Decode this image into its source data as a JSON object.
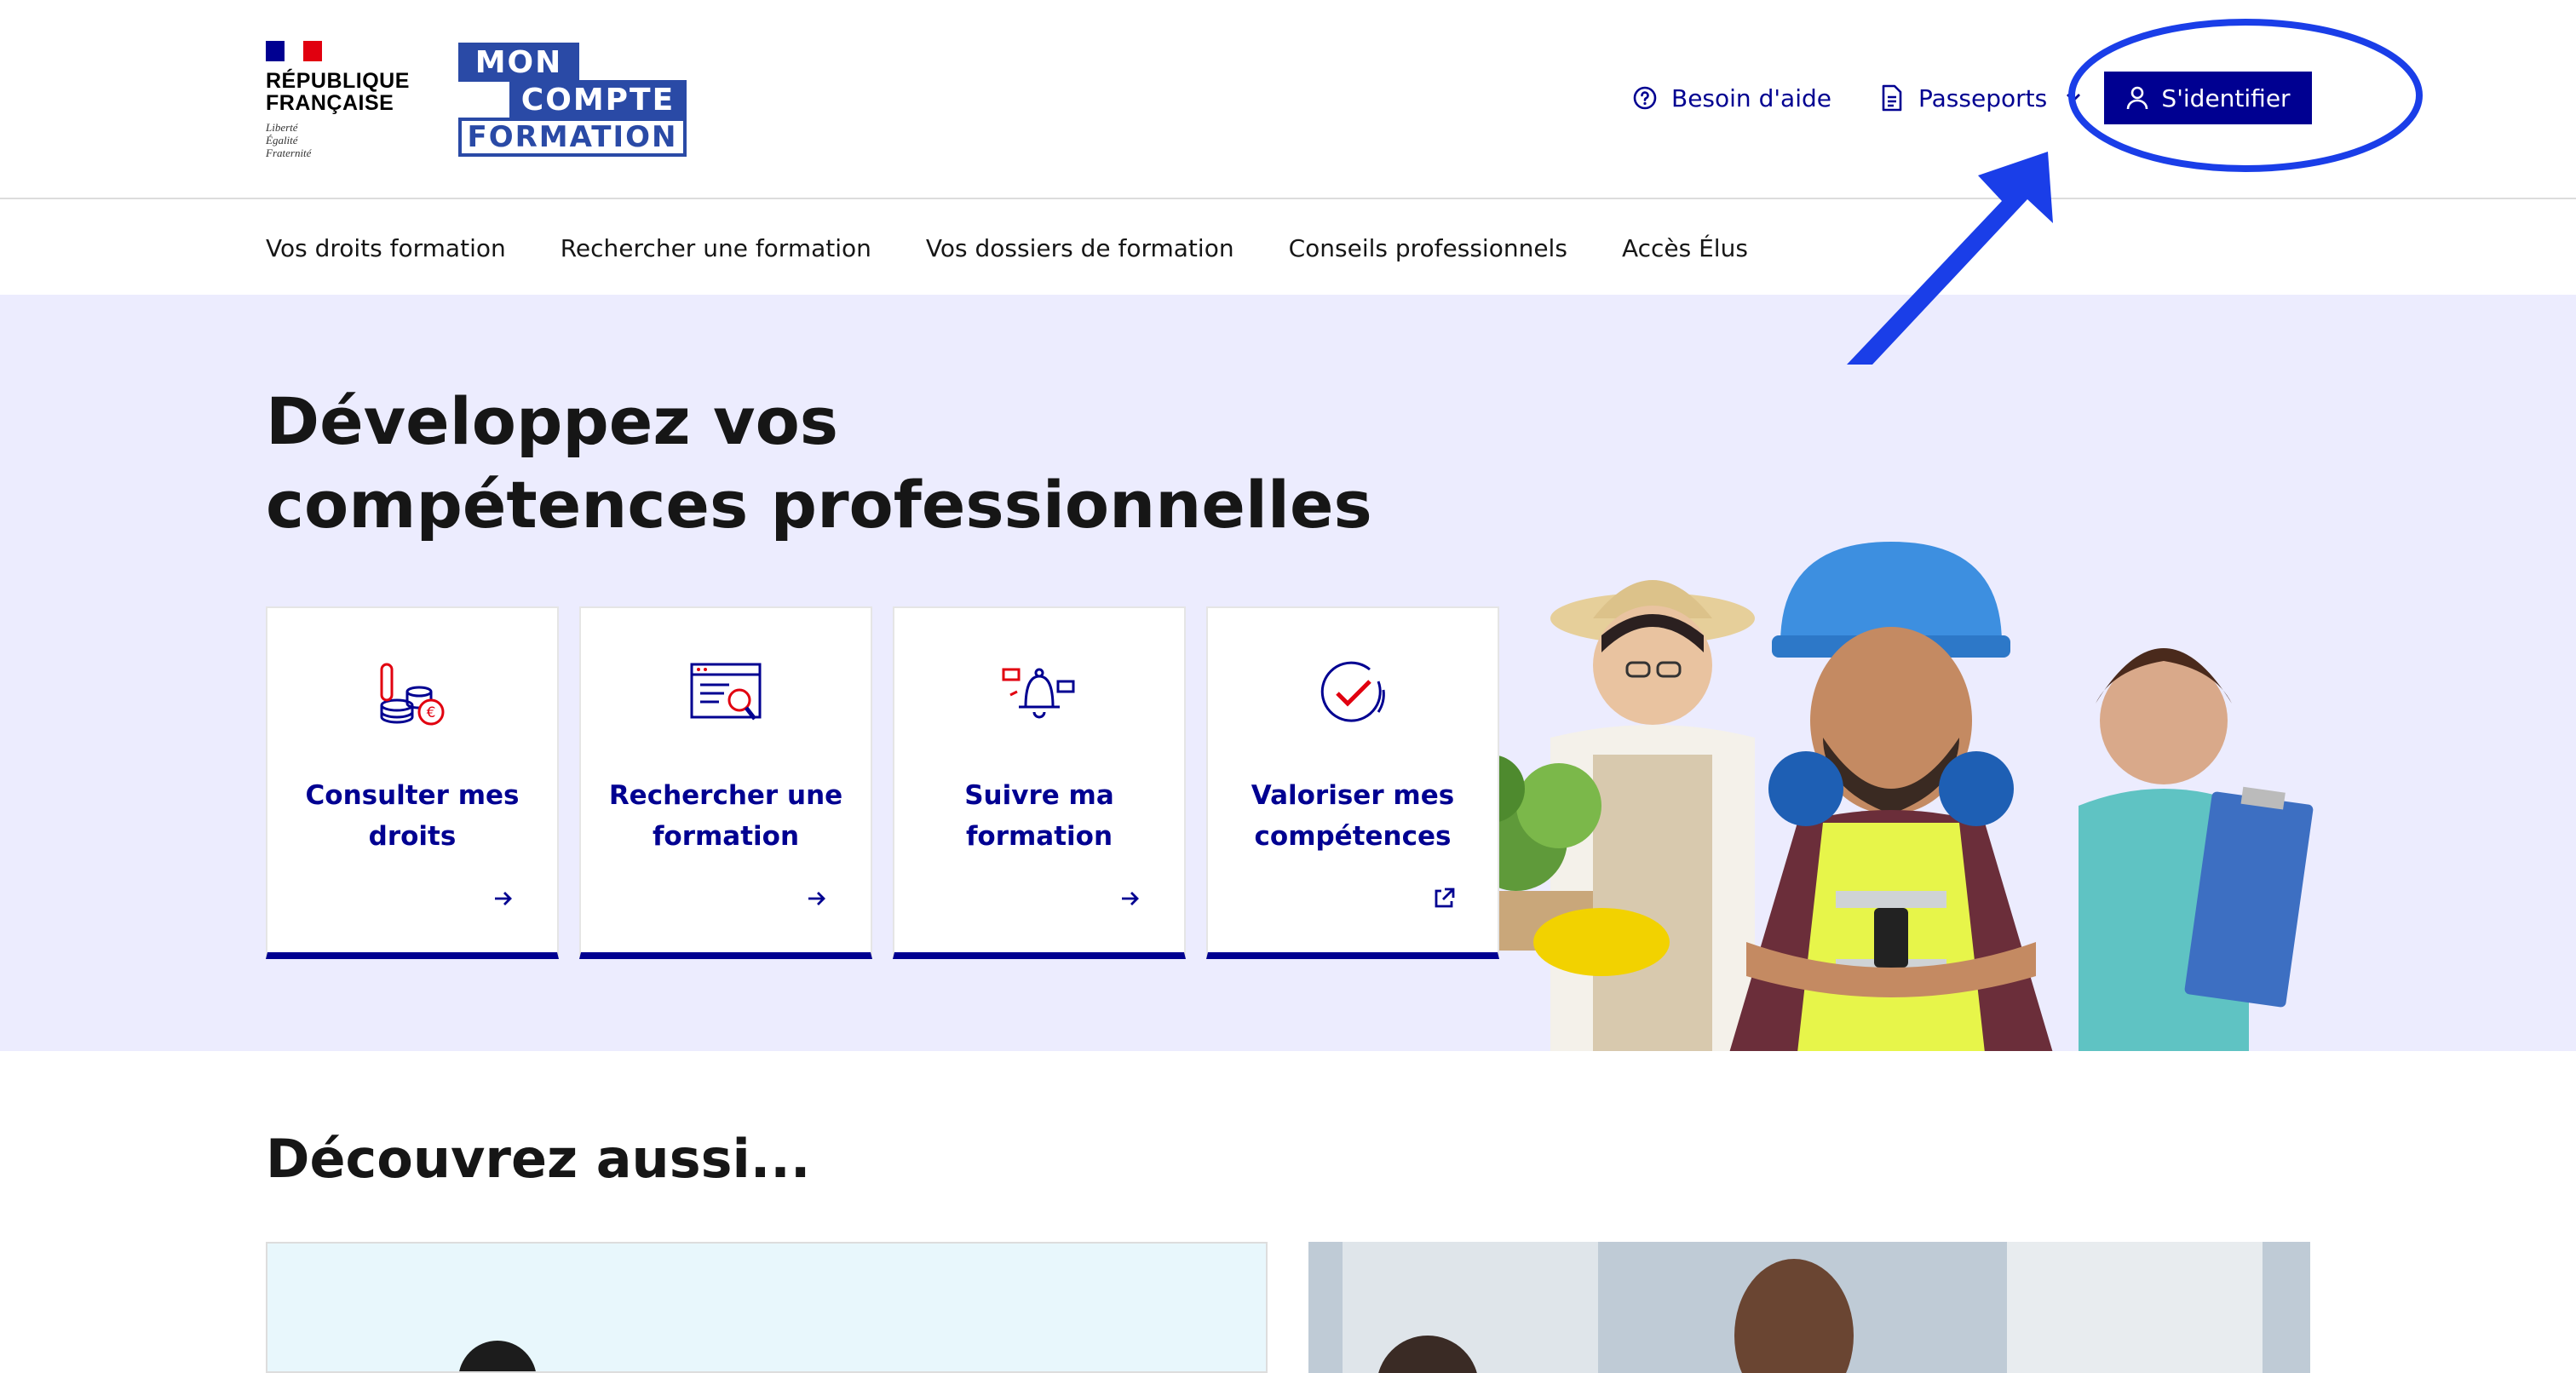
{
  "header": {
    "republic": {
      "name_line1": "RÉPUBLIQUE",
      "name_line2": "FRANÇAISE",
      "motto_line1": "Liberté",
      "motto_line2": "Égalité",
      "motto_line3": "Fraternité"
    },
    "logo": {
      "line1": "MON",
      "line2": "COMPTE",
      "line3": "FORMATION"
    },
    "help_label": "Besoin d'aide",
    "passports_label": "Passeports",
    "login_label": "S'identifier"
  },
  "nav": {
    "items": [
      {
        "label": "Vos droits formation"
      },
      {
        "label": "Rechercher une formation"
      },
      {
        "label": "Vos dossiers de formation"
      },
      {
        "label": "Conseils professionnels"
      },
      {
        "label": "Accès Élus"
      }
    ]
  },
  "hero": {
    "title_line1": "Développez vos",
    "title_line2": "compétences professionnelles",
    "cards": [
      {
        "label": "Consulter mes droits",
        "icon": "coins-euro-icon",
        "arrow": "arrow-right-icon"
      },
      {
        "label": "Rechercher une formation",
        "icon": "search-document-icon",
        "arrow": "arrow-right-icon"
      },
      {
        "label": "Suivre ma formation",
        "icon": "notification-bell-icon",
        "arrow": "arrow-right-icon"
      },
      {
        "label": "Valoriser mes compétences",
        "icon": "check-circle-icon",
        "arrow": "external-link-icon"
      }
    ]
  },
  "discover": {
    "title": "Découvrez aussi..."
  },
  "colors": {
    "brand_blue": "#000091",
    "hero_bg": "#ececfe",
    "annotation_blue": "#1a3ee8",
    "accent_red": "#e1000f"
  }
}
